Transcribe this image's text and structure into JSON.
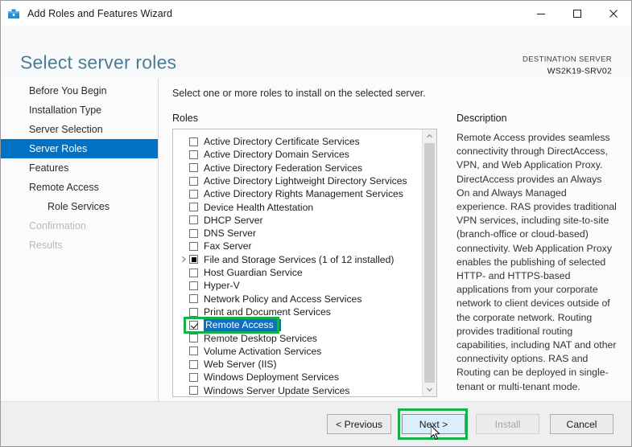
{
  "window": {
    "title": "Add Roles and Features Wizard",
    "icon": "wizard-toolbox-icon",
    "controls": {
      "minimize": "─",
      "maximize": "□",
      "close": "✕"
    }
  },
  "header": {
    "page_title": "Select server roles",
    "destination_label": "DESTINATION SERVER",
    "destination_value": "WS2K19-SRV02"
  },
  "sidebar": {
    "items": [
      {
        "label": "Before You Begin",
        "state": "normal",
        "indent": false
      },
      {
        "label": "Installation Type",
        "state": "normal",
        "indent": false
      },
      {
        "label": "Server Selection",
        "state": "normal",
        "indent": false
      },
      {
        "label": "Server Roles",
        "state": "active",
        "indent": false
      },
      {
        "label": "Features",
        "state": "normal",
        "indent": false
      },
      {
        "label": "Remote Access",
        "state": "normal",
        "indent": false
      },
      {
        "label": "Role Services",
        "state": "normal",
        "indent": true
      },
      {
        "label": "Confirmation",
        "state": "disabled",
        "indent": false
      },
      {
        "label": "Results",
        "state": "disabled",
        "indent": false
      }
    ]
  },
  "main": {
    "instruction": "Select one or more roles to install on the selected server.",
    "roles_label": "Roles",
    "roles": [
      {
        "label": "Active Directory Certificate Services",
        "checkbox": "unchecked",
        "expandable": false,
        "selected": false
      },
      {
        "label": "Active Directory Domain Services",
        "checkbox": "unchecked",
        "expandable": false,
        "selected": false
      },
      {
        "label": "Active Directory Federation Services",
        "checkbox": "unchecked",
        "expandable": false,
        "selected": false
      },
      {
        "label": "Active Directory Lightweight Directory Services",
        "checkbox": "unchecked",
        "expandable": false,
        "selected": false
      },
      {
        "label": "Active Directory Rights Management Services",
        "checkbox": "unchecked",
        "expandable": false,
        "selected": false
      },
      {
        "label": "Device Health Attestation",
        "checkbox": "unchecked",
        "expandable": false,
        "selected": false
      },
      {
        "label": "DHCP Server",
        "checkbox": "unchecked",
        "expandable": false,
        "selected": false
      },
      {
        "label": "DNS Server",
        "checkbox": "unchecked",
        "expandable": false,
        "selected": false
      },
      {
        "label": "Fax Server",
        "checkbox": "unchecked",
        "expandable": false,
        "selected": false
      },
      {
        "label": "File and Storage Services (1 of 12 installed)",
        "checkbox": "partial",
        "expandable": true,
        "selected": false
      },
      {
        "label": "Host Guardian Service",
        "checkbox": "unchecked",
        "expandable": false,
        "selected": false
      },
      {
        "label": "Hyper-V",
        "checkbox": "unchecked",
        "expandable": false,
        "selected": false
      },
      {
        "label": "Network Policy and Access Services",
        "checkbox": "unchecked",
        "expandable": false,
        "selected": false
      },
      {
        "label": "Print and Document Services",
        "checkbox": "unchecked",
        "expandable": false,
        "selected": false
      },
      {
        "label": "Remote Access",
        "checkbox": "checked",
        "expandable": false,
        "selected": true
      },
      {
        "label": "Remote Desktop Services",
        "checkbox": "unchecked",
        "expandable": false,
        "selected": false
      },
      {
        "label": "Volume Activation Services",
        "checkbox": "unchecked",
        "expandable": false,
        "selected": false
      },
      {
        "label": "Web Server (IIS)",
        "checkbox": "unchecked",
        "expandable": false,
        "selected": false
      },
      {
        "label": "Windows Deployment Services",
        "checkbox": "unchecked",
        "expandable": false,
        "selected": false
      },
      {
        "label": "Windows Server Update Services",
        "checkbox": "unchecked",
        "expandable": false,
        "selected": false
      }
    ],
    "description_title": "Description",
    "description_text": "Remote Access provides seamless connectivity through DirectAccess, VPN, and Web Application Proxy. DirectAccess provides an Always On and Always Managed experience. RAS provides traditional VPN services, including site-to-site (branch-office or cloud-based) connectivity. Web Application Proxy enables the publishing of selected HTTP- and HTTPS-based applications from your corporate network to client devices outside of the corporate network. Routing provides traditional routing capabilities, including NAT and other connectivity options. RAS and Routing can be deployed in single-tenant or multi-tenant mode."
  },
  "footer": {
    "previous_label": "< Previous",
    "next_label": "Next >",
    "install_label": "Install",
    "cancel_label": "Cancel"
  },
  "annotations": {
    "highlight_color": "#14b14a",
    "accent_blue": "#0072c6",
    "selection_blue": "#0c6ec4",
    "title_color": "#4a7d96"
  }
}
